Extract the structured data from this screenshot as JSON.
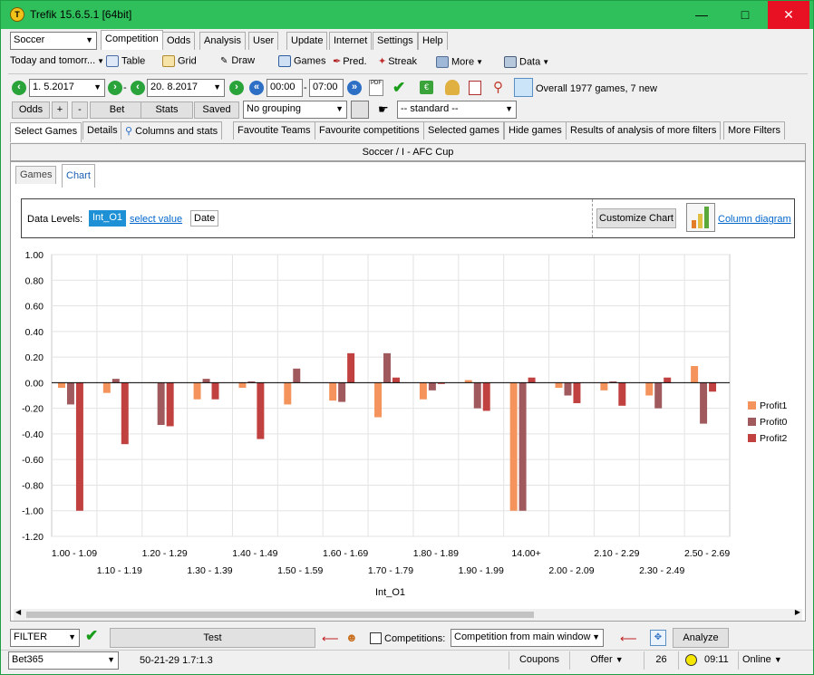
{
  "window": {
    "title": "Trefik 15.6.5.1 [64bit]"
  },
  "sport_select": "Soccer",
  "period_select": "Today and tomorr...",
  "menu_tabs": [
    "Competition",
    "Odds",
    "Analysis",
    "User",
    "Update",
    "Internet",
    "Settings",
    "Help"
  ],
  "toolbar": {
    "table": "Table",
    "grid": "Grid",
    "draw": "Draw",
    "games": "Games",
    "pred": "Pred.",
    "streak": "Streak",
    "more": "More",
    "data": "Data"
  },
  "date_bar": {
    "date_from": "1.  5.2017",
    "date_to": "20.  8.2017",
    "time_from": "00:00",
    "time_to": "07:00",
    "sep": "-",
    "summary": "Overall 1977 games, 7 new"
  },
  "row2": {
    "odds": "Odds",
    "plus": "+",
    "minus": "-",
    "bet": "Bet",
    "stats": "Stats",
    "saved": "Saved",
    "grouping": "No grouping",
    "standard": "-- standard --"
  },
  "sub_tabs": [
    "Select Games",
    "Details",
    "Columns and stats",
    "Favoutite Teams",
    "Favourite competitions",
    "Selected games",
    "Hide games",
    "Results of analysis of more filters",
    "More Filters"
  ],
  "section_title": "Soccer / I - AFC Cup",
  "view_tabs": [
    "Games",
    "Chart"
  ],
  "chart_controls": {
    "data_levels_label": "Data Levels:",
    "level_value": "Int_O1",
    "select_value": "select value",
    "date_label": "Date",
    "customize": "Customize Chart",
    "column_diagram": "Column diagram"
  },
  "chart_data": {
    "type": "bar",
    "xlabel": "Int_O1",
    "ylim": [
      -1.2,
      1.0
    ],
    "yticks": [
      "1.00",
      "0.80",
      "0.60",
      "0.40",
      "0.20",
      "0.00",
      "-0.20",
      "-0.40",
      "-0.60",
      "-0.80",
      "-1.00",
      "-1.20"
    ],
    "categories": [
      "1.00 - 1.09",
      "1.10 - 1.19",
      "1.20 - 1.29",
      "1.30 - 1.39",
      "1.40 - 1.49",
      "1.50 - 1.59",
      "1.60 - 1.69",
      "1.70 - 1.79",
      "1.80 - 1.89",
      "1.90 - 1.99",
      "14.00+",
      "2.00 - 2.09",
      "2.10 - 2.29",
      "2.30 - 2.49",
      "2.50 - 2.69"
    ],
    "series": [
      {
        "name": "Profit1",
        "color": "#f5935c",
        "values": [
          -0.04,
          -0.08,
          0.0,
          -0.13,
          -0.04,
          -0.17,
          -0.14,
          -0.27,
          -0.13,
          0.02,
          -1.0,
          -0.04,
          -0.06,
          -0.1,
          0.13
        ]
      },
      {
        "name": "Profit0",
        "color": "#a0595d",
        "values": [
          -0.17,
          0.03,
          -0.33,
          0.03,
          0.01,
          0.11,
          -0.15,
          0.23,
          -0.06,
          -0.2,
          -1.0,
          -0.1,
          0.01,
          -0.2,
          -0.32
        ]
      },
      {
        "name": "Profit2",
        "color": "#c0413f",
        "values": [
          -1.0,
          -0.48,
          -0.34,
          -0.13,
          -0.44,
          0.0,
          0.23,
          0.04,
          -0.01,
          -0.22,
          0.04,
          -0.16,
          -0.18,
          0.04,
          -0.07
        ]
      }
    ],
    "legend": "right"
  },
  "filter_bar": {
    "filter": "FILTER",
    "test": "Test",
    "competitions": "Competitions:",
    "comp_source": "Competition from main window",
    "analyze": "Analyze"
  },
  "status": {
    "bookmaker": "Bet365",
    "record": "50-21-29  1.7:1.3",
    "coupons": "Coupons",
    "offer": "Offer",
    "count": "26",
    "time": "09:11",
    "online": "Online"
  }
}
